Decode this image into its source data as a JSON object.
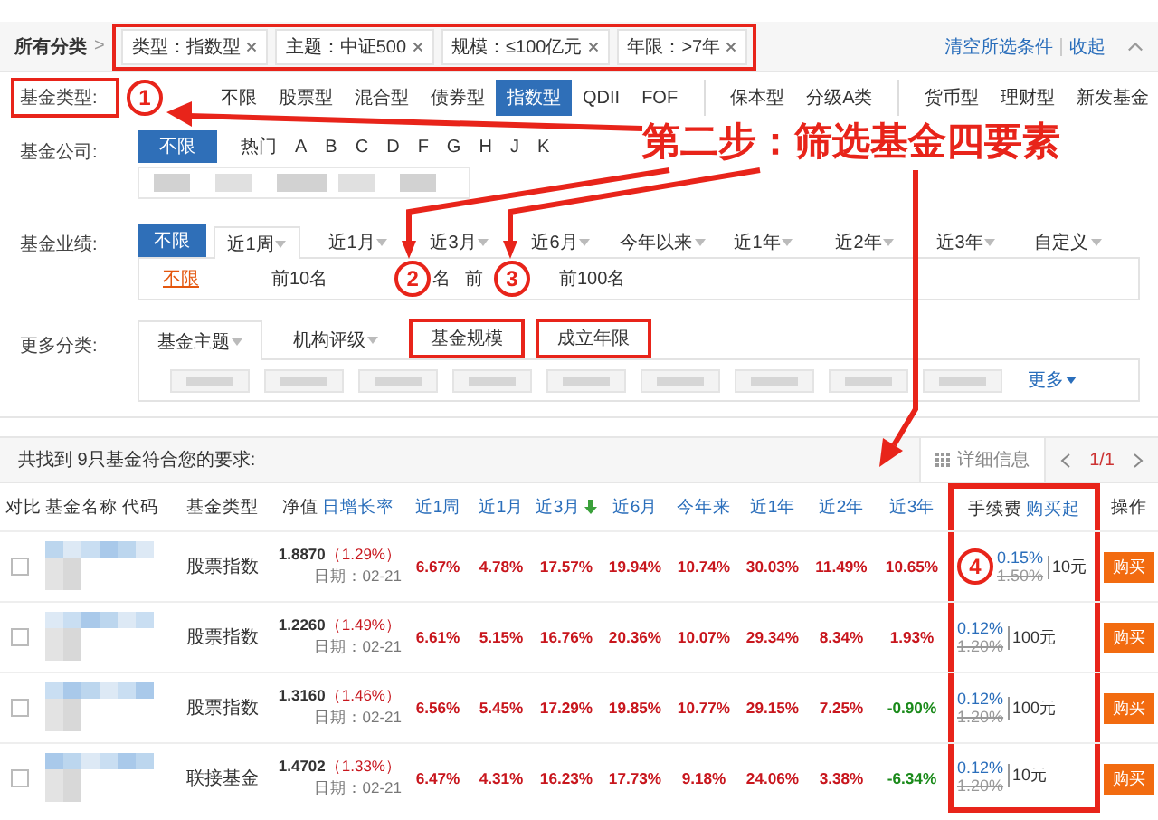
{
  "filter_bar": {
    "label": "所有分类",
    "separator": ">",
    "highlighted": true,
    "tags": [
      {
        "label": "类型：指数型"
      },
      {
        "label": "主题：中证500"
      },
      {
        "label": "规模：≤100亿元"
      },
      {
        "label": "年限：>7年"
      }
    ],
    "clear_link": "清空所选条件",
    "collapse_link": "收起"
  },
  "fund_type": {
    "label": "基金类型:",
    "highlighted": true,
    "options": [
      {
        "label": "不限",
        "selected": false,
        "divider_before": false
      },
      {
        "label": "股票型",
        "selected": false,
        "divider_before": false
      },
      {
        "label": "混合型",
        "selected": false,
        "divider_before": false
      },
      {
        "label": "债券型",
        "selected": false,
        "divider_before": false
      },
      {
        "label": "指数型",
        "selected": true,
        "divider_before": false
      },
      {
        "label": "QDII",
        "selected": false,
        "divider_before": false
      },
      {
        "label": "FOF",
        "selected": false,
        "divider_before": false
      },
      {
        "label": "保本型",
        "selected": false,
        "divider_before": true
      },
      {
        "label": "分级A类",
        "selected": false,
        "divider_before": false
      },
      {
        "label": "货币型",
        "selected": false,
        "divider_before": true
      },
      {
        "label": "理财型",
        "selected": false,
        "divider_before": false
      },
      {
        "label": "新发基金",
        "selected": false,
        "divider_before": false
      }
    ]
  },
  "fund_company": {
    "label": "基金公司:",
    "options": [
      {
        "label": "不限",
        "selected": true
      },
      {
        "label": "热门",
        "selected": false
      },
      {
        "label": "A",
        "selected": false
      },
      {
        "label": "B",
        "selected": false
      },
      {
        "label": "C",
        "selected": false
      },
      {
        "label": "D",
        "selected": false
      },
      {
        "label": "F",
        "selected": false
      },
      {
        "label": "G",
        "selected": false
      },
      {
        "label": "H",
        "selected": false
      },
      {
        "label": "J",
        "selected": false
      },
      {
        "label": "K",
        "selected": false
      }
    ]
  },
  "performance": {
    "label": "基金业绩:",
    "all_button": "不限",
    "periods": [
      {
        "label": "近1周",
        "selected": true
      },
      {
        "label": "近1月",
        "selected": false
      },
      {
        "label": "近3月",
        "selected": false
      },
      {
        "label": "近6月",
        "selected": false
      },
      {
        "label": "今年以来",
        "selected": false
      },
      {
        "label": "近1年",
        "selected": false
      },
      {
        "label": "近2年",
        "selected": false
      },
      {
        "label": "近3年",
        "selected": false
      },
      {
        "label": "自定义",
        "selected": false
      }
    ],
    "ranks": [
      {
        "label": "不限",
        "selected": true
      },
      {
        "label": "前10名",
        "selected": false
      },
      {
        "label": "名",
        "selected": false
      },
      {
        "label": "前",
        "selected": false
      },
      {
        "label": "前100名",
        "selected": false
      }
    ]
  },
  "more_categories": {
    "label": "更多分类:",
    "tabs": [
      {
        "label": "基金主题",
        "selected": true,
        "highlighted": false,
        "caret": true
      },
      {
        "label": "机构评级",
        "selected": false,
        "highlighted": false,
        "caret": true
      },
      {
        "label": "基金规模",
        "selected": false,
        "highlighted": true,
        "caret": false
      },
      {
        "label": "成立年限",
        "selected": false,
        "highlighted": true,
        "caret": false
      }
    ],
    "chips": [
      {
        "kind": "blurred"
      },
      {
        "kind": "blurred"
      },
      {
        "kind": "blurred"
      },
      {
        "kind": "blurred"
      },
      {
        "kind": "blurred"
      },
      {
        "kind": "blurred"
      },
      {
        "kind": "blurred"
      },
      {
        "kind": "blurred"
      },
      {
        "kind": "blurred"
      }
    ],
    "more_link": "更多"
  },
  "results": {
    "summary": "共找到 9只基金符合您的要求:",
    "detail_button": "详细信息",
    "pager": "1/1"
  },
  "table": {
    "columns": [
      {
        "label": "对比",
        "kind": "plain"
      },
      {
        "label": "基金名称 代码",
        "kind": "plain"
      },
      {
        "label": "基金类型",
        "kind": "plain"
      },
      {
        "label": "净值",
        "label2": "日增长率",
        "kind": "split"
      },
      {
        "label": "近1周",
        "kind": "link"
      },
      {
        "label": "近1月",
        "kind": "link"
      },
      {
        "label": "近3月",
        "kind": "sorted"
      },
      {
        "label": "近6月",
        "kind": "link"
      },
      {
        "label": "今年来",
        "kind": "link"
      },
      {
        "label": "近1年",
        "kind": "link"
      },
      {
        "label": "近2年",
        "kind": "link"
      },
      {
        "label": "近3年",
        "kind": "link"
      },
      {
        "label": "手续费",
        "label2": "购买起",
        "kind": "split"
      },
      {
        "label": "操作",
        "kind": "plain"
      }
    ],
    "fee_highlighted": true,
    "rows": [
      {
        "checked": false,
        "type": "股票指数",
        "nav": "1.8870",
        "change": "（1.29%）",
        "date": "日期：02-21",
        "returns": [
          "6.67%",
          "4.78%",
          "17.57%",
          "19.94%",
          "10.74%",
          "30.03%",
          "11.49%",
          "10.65%"
        ],
        "fee": "0.15%",
        "fee_original": "1.50%",
        "minimum": "10元",
        "action": "购买"
      },
      {
        "checked": false,
        "type": "股票指数",
        "nav": "1.2260",
        "change": "（1.49%）",
        "date": "日期：02-21",
        "returns": [
          "6.61%",
          "5.15%",
          "16.76%",
          "20.36%",
          "10.07%",
          "29.34%",
          "8.34%",
          "1.93%"
        ],
        "fee": "0.12%",
        "fee_original": "1.20%",
        "minimum": "100元",
        "action": "购买"
      },
      {
        "checked": false,
        "type": "股票指数",
        "nav": "1.3160",
        "change": "（1.46%）",
        "date": "日期：02-21",
        "returns": [
          "6.56%",
          "5.45%",
          "17.29%",
          "19.85%",
          "10.77%",
          "29.15%",
          "7.25%",
          "-0.90%"
        ],
        "fee": "0.12%",
        "fee_original": "1.20%",
        "minimum": "100元",
        "action": "购买"
      },
      {
        "checked": false,
        "type": "联接基金",
        "nav": "1.4702",
        "change": "（1.33%）",
        "date": "日期：02-21",
        "returns": [
          "6.47%",
          "4.31%",
          "16.23%",
          "17.73%",
          "9.18%",
          "24.06%",
          "3.38%",
          "-6.34%"
        ],
        "fee": "0.12%",
        "fee_original": "1.20%",
        "minimum": "10元",
        "action": "购买"
      }
    ]
  },
  "annotations": {
    "headline": "第二步：筛选基金四要素",
    "markers": [
      "1",
      "2",
      "3",
      "4"
    ]
  }
}
